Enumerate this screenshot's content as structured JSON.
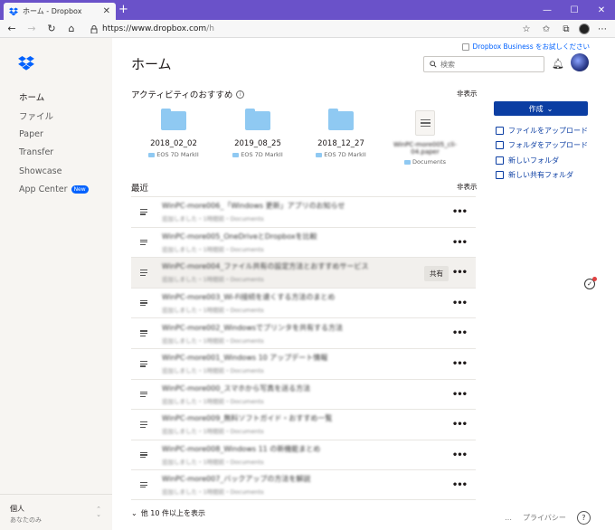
{
  "browser": {
    "tab_title": "ホーム - Dropbox",
    "tab_close": "✕",
    "new_tab": "+",
    "url_prefix": "https://www.dropbox.com",
    "url_path": "/h",
    "win_min": "—",
    "win_max": "☐",
    "win_close": "✕"
  },
  "sidebar": {
    "items": [
      {
        "label": "ホーム",
        "active": true
      },
      {
        "label": "ファイル"
      },
      {
        "label": "Paper"
      },
      {
        "label": "Transfer"
      },
      {
        "label": "Showcase"
      },
      {
        "label": "App Center",
        "badge": "New"
      }
    ],
    "footer": {
      "account": "個人",
      "member": "あなたのみ"
    }
  },
  "header": {
    "promo": "Dropbox Business をお試しください",
    "title": "ホーム",
    "search_placeholder": "検索"
  },
  "suggestions": {
    "heading": "アクティビティのおすすめ",
    "hide": "非表示",
    "items": [
      {
        "name": "2018_02_02",
        "location": "EOS 7D MarkII",
        "type": "folder"
      },
      {
        "name": "2019_08_25",
        "location": "EOS 7D MarkII",
        "type": "folder"
      },
      {
        "name": "2018_12_27",
        "location": "EOS 7D MarkII",
        "type": "folder"
      },
      {
        "name": "WinPC-more005_cli-04.paper",
        "location": "Documents",
        "type": "doc"
      }
    ]
  },
  "recent": {
    "heading": "最近",
    "hide": "非表示",
    "share_label": "共有",
    "show_more": "他 10 件以上を表示",
    "rows": [
      {
        "title": "WinPC-more006_「Windows 更新」アプリのお知らせ",
        "sub": "追加しました・1時間前・Documents"
      },
      {
        "title": "WinPC-more005_OneDriveとDropboxを比較",
        "sub": "追加しました・1時間前・Documents"
      },
      {
        "title": "WinPC-more004_ファイル共有の設定方法とおすすめサービス",
        "sub": "追加しました・1時間前・Documents"
      },
      {
        "title": "WinPC-more003_Wi-Fi接続を速くする方法のまとめ",
        "sub": "追加しました・1時間前・Documents"
      },
      {
        "title": "WinPC-more002_Windowsでプリンタを共有する方法",
        "sub": "追加しました・1時間前・Documents"
      },
      {
        "title": "WinPC-more001_Windows 10 アップデート情報",
        "sub": "追加しました・1時間前・Documents"
      },
      {
        "title": "WinPC-more000_スマホから写真を送る方法",
        "sub": "追加しました・1時間前・Documents"
      },
      {
        "title": "WinPC-more009_無料ソフトガイド・おすすめ一覧",
        "sub": "追加しました・1時間前・Documents"
      },
      {
        "title": "WinPC-more008_Windows 11 の新機能まとめ",
        "sub": "追加しました・1時間前・Documents"
      },
      {
        "title": "WinPC-more007_バックアップの方法を解説",
        "sub": "追加しました・1時間前・Documents"
      }
    ]
  },
  "actions": {
    "create": "作成",
    "items": [
      {
        "label": "ファイルをアップロード"
      },
      {
        "label": "フォルダをアップロード"
      },
      {
        "label": "新しいフォルダ"
      },
      {
        "label": "新しい共有フォルダ"
      }
    ]
  },
  "footer": {
    "more": "…",
    "privacy": "プライバシー",
    "help": "?"
  },
  "colors": {
    "accent": "#0061fe",
    "button": "#0b3ea3",
    "folder": "#8fc9f2",
    "titlebar": "#6a52c9"
  }
}
